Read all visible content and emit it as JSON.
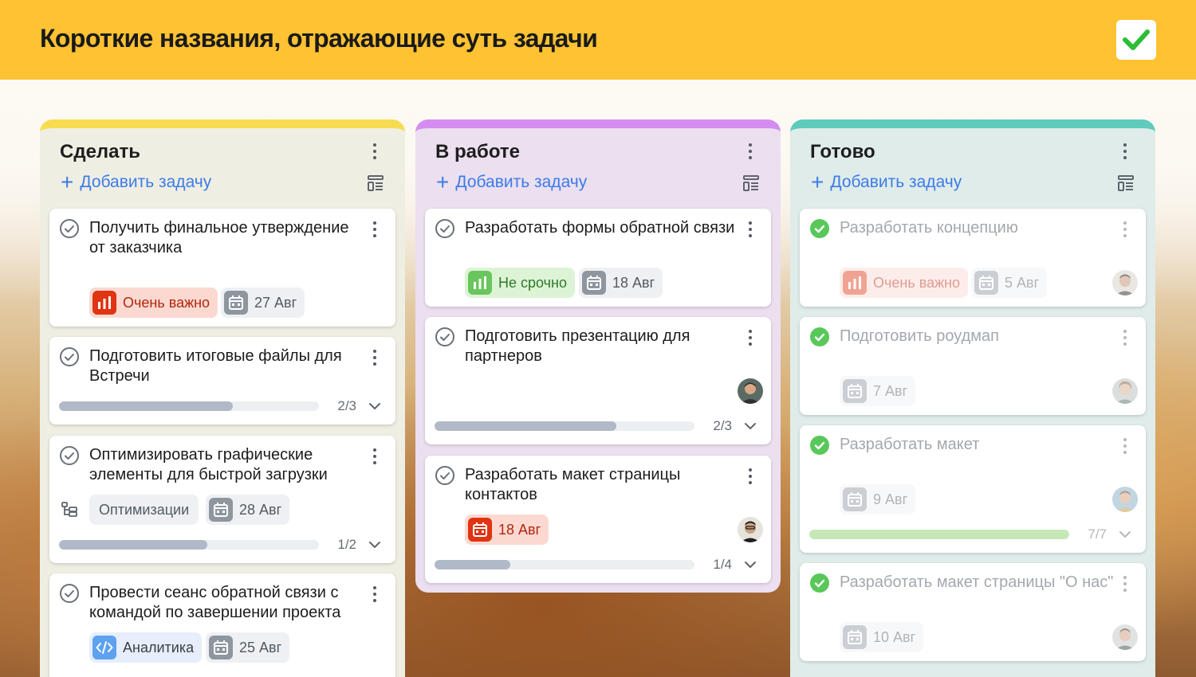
{
  "header": {
    "title": "Короткие названия, отражающие суть задачи"
  },
  "common": {
    "add_task_label": "Добавить задачу"
  },
  "colors": {
    "header_bg": "#fec233",
    "todo_accent": "#f7dc4f",
    "work_accent": "#d58cf0",
    "done_accent": "#5fcbbd",
    "link_blue": "#3d7be6",
    "done_green": "#59c85a"
  },
  "columns": [
    {
      "title": "Сделать",
      "cards": [
        {
          "title": "Получить финальное утверждение от заказчика",
          "priority": "Очень важно",
          "date": "27 Авг"
        },
        {
          "title": "Подготовить итоговые файлы для Встречи",
          "progress": 0.67,
          "progress_label": "2/3"
        },
        {
          "title": "Оптимизировать графические элементы для быстрой загрузки",
          "tag": "Оптимизации",
          "date": "28 Авг",
          "progress": 0.57,
          "progress_label": "1/2"
        },
        {
          "title": "Провести сеанс обратной связи с командой по завершении проекта",
          "tag": "Аналитика",
          "date": "25 Авг"
        }
      ]
    },
    {
      "title": "В работе",
      "cards": [
        {
          "title": "Разработать формы обратной связи",
          "priority": "Не срочно",
          "date": "18 Авг"
        },
        {
          "title": "Подготовить презентацию для партнеров",
          "progress": 0.7,
          "progress_label": "2/3"
        },
        {
          "title": "Разработать макет страницы контактов",
          "date": "18 Авг",
          "progress": 0.29,
          "progress_label": "1/4"
        }
      ]
    },
    {
      "title": "Готово",
      "cards": [
        {
          "title": "Разработать концепцию",
          "priority": "Очень важно",
          "date": "5 Авг"
        },
        {
          "title": "Подготовить роудмап",
          "date": "7 Авг"
        },
        {
          "title": "Разработать макет",
          "date": "9 Авг",
          "progress": 1.0,
          "progress_label": "7/7"
        },
        {
          "title": "Разработать макет страницы \"О нас\"",
          "date": "10 Авг"
        }
      ]
    }
  ],
  "icons": {
    "header": "checkmark-icon",
    "column_menu": "more-vertical-icon",
    "column_layout": "layout-icon",
    "card_status_open": "check-circle-outline-icon",
    "card_status_done": "check-circle-filled-icon",
    "priority": "bar-chart-icon",
    "date": "calendar-icon",
    "analytics": "code-icon",
    "subtasks": "subtask-tree-icon",
    "expand": "chevron-down-icon"
  }
}
